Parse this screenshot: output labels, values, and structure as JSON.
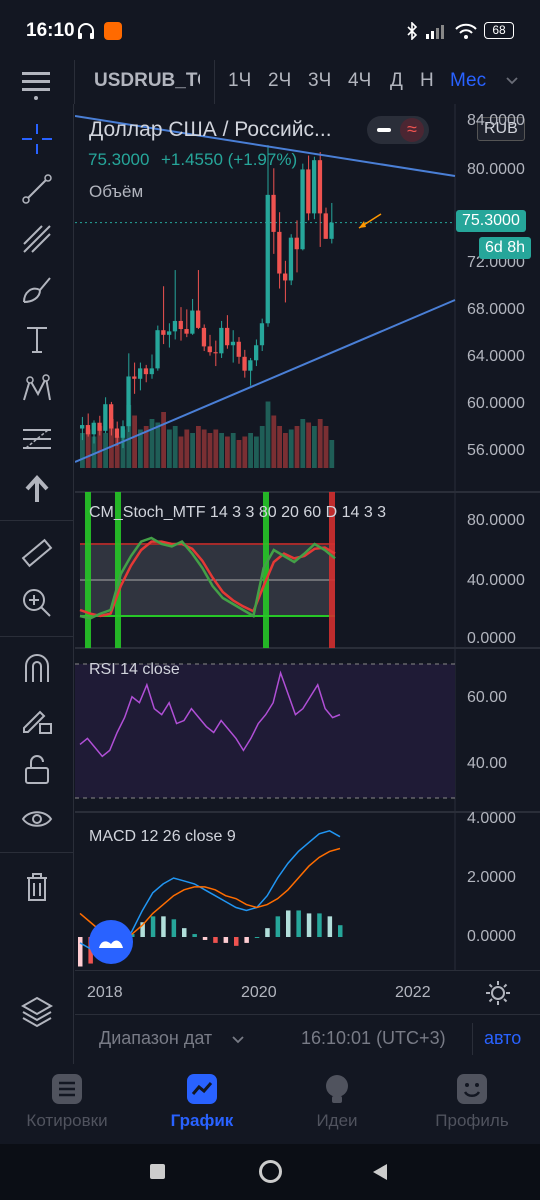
{
  "status_bar": {
    "time": "16:10",
    "battery": "68"
  },
  "top_bar": {
    "symbol": "USDRUB_TO",
    "timeframes": [
      "1Ч",
      "2Ч",
      "3Ч",
      "4Ч",
      "Д",
      "Н",
      "Мес"
    ],
    "active_timeframe": "Мес"
  },
  "legend": {
    "title": "Доллар США / Российс...",
    "price": "75.3000",
    "change": "+1.4550 (+1.97%)",
    "volume_label": "Объём",
    "currency": "RUB"
  },
  "price_axis": {
    "ticks": [
      "84.0000",
      "80.0000",
      "72.0000",
      "68.0000",
      "64.0000",
      "60.0000",
      "56.0000"
    ],
    "current_price": "75.3000",
    "countdown": "6d 8h"
  },
  "stoch_panel": {
    "label": "CM_Stoch_MTF 14 3 3 80 20 60 D 14 3 3",
    "ticks": [
      "80.0000",
      "40.0000",
      "0.0000"
    ]
  },
  "rsi_panel": {
    "label": "RSI 14 close",
    "ticks": [
      "60.00",
      "40.00"
    ]
  },
  "macd_panel": {
    "label": "MACD 12 26 close 9",
    "ticks": [
      "4.0000",
      "2.0000",
      "0.0000"
    ]
  },
  "time_axis": {
    "labels": [
      "2018",
      "2020",
      "2022"
    ]
  },
  "bottom_bar": {
    "date_range": "Диапазон дат",
    "clock": "16:10:01 (UTC+3)",
    "auto": "авто"
  },
  "nav": {
    "quotes": "Котировки",
    "chart": "График",
    "ideas": "Идеи",
    "profile": "Профиль"
  },
  "colors": {
    "up": "#26a69a",
    "down": "#ef5350",
    "accent": "#2962ff",
    "trendline": "#4a7fd6",
    "background": "#131722"
  },
  "chart_data": {
    "type": "candlestick",
    "title": "Доллар США / Российс...",
    "interval": "Мес",
    "ylim": [
      54,
      84
    ],
    "candles": [
      {
        "o": 57.5,
        "h": 58.5,
        "l": 56.5,
        "c": 57.8
      },
      {
        "o": 57.8,
        "h": 58.8,
        "l": 56.8,
        "c": 57.0
      },
      {
        "o": 57.0,
        "h": 58.2,
        "l": 56.2,
        "c": 58.0
      },
      {
        "o": 58.0,
        "h": 58.6,
        "l": 56.9,
        "c": 57.3
      },
      {
        "o": 57.3,
        "h": 60.2,
        "l": 57.1,
        "c": 59.6
      },
      {
        "o": 59.6,
        "h": 59.8,
        "l": 56.9,
        "c": 57.5
      },
      {
        "o": 57.5,
        "h": 58.1,
        "l": 56.0,
        "c": 56.7
      },
      {
        "o": 56.7,
        "h": 58.2,
        "l": 55.8,
        "c": 57.7
      },
      {
        "o": 57.7,
        "h": 64.0,
        "l": 57.2,
        "c": 62.0
      },
      {
        "o": 62.0,
        "h": 63.2,
        "l": 60.5,
        "c": 61.8
      },
      {
        "o": 61.8,
        "h": 63.2,
        "l": 60.8,
        "c": 62.7
      },
      {
        "o": 62.7,
        "h": 63.0,
        "l": 61.5,
        "c": 62.2
      },
      {
        "o": 62.2,
        "h": 63.9,
        "l": 61.8,
        "c": 62.7
      },
      {
        "o": 62.7,
        "h": 66.4,
        "l": 62.5,
        "c": 66.0
      },
      {
        "o": 66.0,
        "h": 69.8,
        "l": 64.8,
        "c": 65.6
      },
      {
        "o": 65.6,
        "h": 66.6,
        "l": 64.5,
        "c": 65.9
      },
      {
        "o": 65.9,
        "h": 71.2,
        "l": 65.2,
        "c": 66.8
      },
      {
        "o": 66.8,
        "h": 68.0,
        "l": 65.1,
        "c": 66.1
      },
      {
        "o": 66.1,
        "h": 67.8,
        "l": 65.4,
        "c": 65.7
      },
      {
        "o": 65.7,
        "h": 68.7,
        "l": 65.6,
        "c": 67.7
      },
      {
        "o": 67.7,
        "h": 71.2,
        "l": 66.1,
        "c": 66.2
      },
      {
        "o": 66.2,
        "h": 66.5,
        "l": 64.2,
        "c": 64.6
      },
      {
        "o": 64.6,
        "h": 65.6,
        "l": 63.8,
        "c": 64.1
      },
      {
        "o": 64.1,
        "h": 65.1,
        "l": 62.9,
        "c": 64.0
      },
      {
        "o": 64.0,
        "h": 66.8,
        "l": 63.6,
        "c": 66.2
      },
      {
        "o": 66.2,
        "h": 67.3,
        "l": 64.4,
        "c": 64.7
      },
      {
        "o": 64.7,
        "h": 66.0,
        "l": 63.2,
        "c": 65.0
      },
      {
        "o": 65.0,
        "h": 65.4,
        "l": 63.1,
        "c": 63.7
      },
      {
        "o": 63.7,
        "h": 64.3,
        "l": 61.9,
        "c": 62.5
      },
      {
        "o": 62.5,
        "h": 63.6,
        "l": 61.2,
        "c": 63.4
      },
      {
        "o": 63.4,
        "h": 65.2,
        "l": 62.9,
        "c": 64.7
      },
      {
        "o": 64.7,
        "h": 67.0,
        "l": 64.2,
        "c": 66.6
      },
      {
        "o": 66.6,
        "h": 82.0,
        "l": 66.3,
        "c": 77.7
      },
      {
        "o": 77.7,
        "h": 80.0,
        "l": 72.6,
        "c": 74.5
      },
      {
        "o": 74.5,
        "h": 76.2,
        "l": 69.6,
        "c": 70.9
      },
      {
        "o": 70.9,
        "h": 72.0,
        "l": 68.4,
        "c": 70.3
      },
      {
        "o": 70.3,
        "h": 74.3,
        "l": 69.9,
        "c": 74.0
      },
      {
        "o": 74.0,
        "h": 75.5,
        "l": 71.0,
        "c": 73.0
      },
      {
        "o": 73.0,
        "h": 80.4,
        "l": 72.9,
        "c": 79.9
      },
      {
        "o": 79.9,
        "h": 81.1,
        "l": 75.5,
        "c": 76.1
      },
      {
        "o": 76.1,
        "h": 81.0,
        "l": 75.6,
        "c": 80.7
      },
      {
        "o": 80.7,
        "h": 81.4,
        "l": 73.2,
        "c": 76.1
      },
      {
        "o": 76.1,
        "h": 76.6,
        "l": 73.9,
        "c": 73.9
      },
      {
        "o": 73.9,
        "h": 77.0,
        "l": 73.5,
        "c": 75.3
      }
    ],
    "volume": [
      0.5,
      0.55,
      0.45,
      0.6,
      0.5,
      0.7,
      0.45,
      0.55,
      0.9,
      0.75,
      0.55,
      0.6,
      0.7,
      0.65,
      0.8,
      0.55,
      0.6,
      0.45,
      0.55,
      0.5,
      0.6,
      0.55,
      0.5,
      0.55,
      0.5,
      0.45,
      0.5,
      0.4,
      0.45,
      0.5,
      0.45,
      0.6,
      0.95,
      0.75,
      0.6,
      0.5,
      0.55,
      0.6,
      0.7,
      0.65,
      0.6,
      0.7,
      0.6,
      0.4
    ],
    "rsi": [
      48,
      50,
      47,
      44,
      46,
      52,
      57,
      64,
      62,
      68,
      60,
      58,
      62,
      55,
      56,
      60,
      57,
      54,
      52,
      56,
      53,
      50,
      46,
      50,
      55,
      58,
      62,
      72,
      65,
      58,
      60,
      64,
      68,
      60,
      57,
      58
    ],
    "macd": [
      -0.2,
      -0.4,
      -0.5,
      -0.4,
      -0.3,
      0.2,
      0.9,
      1.5,
      1.8,
      2.0,
      1.9,
      1.8,
      1.6,
      1.4,
      1.2,
      1.0,
      0.9,
      1.0,
      1.4,
      2.0,
      2.5,
      2.9,
      3.2,
      3.5,
      3.6,
      3.4
    ],
    "macd_signal": [
      0.8,
      0.5,
      0.2,
      0.0,
      0.0,
      0.1,
      0.4,
      0.8,
      1.1,
      1.4,
      1.6,
      1.7,
      1.7,
      1.6,
      1.4,
      1.3,
      1.1,
      1.0,
      1.1,
      1.3,
      1.6,
      2.0,
      2.4,
      2.7,
      2.9,
      3.0
    ],
    "stoch_k": [
      20,
      18,
      22,
      25,
      55,
      70,
      82,
      85,
      80,
      78,
      82,
      72,
      60,
      45,
      35,
      30,
      25,
      20,
      60,
      75,
      70,
      65,
      72,
      80,
      75,
      68
    ],
    "stoch_d": [
      25,
      22,
      20,
      22,
      45,
      62,
      75,
      82,
      82,
      80,
      80,
      76,
      66,
      52,
      40,
      33,
      28,
      24,
      45,
      65,
      72,
      68,
      70,
      76,
      77,
      72
    ],
    "xlabels": [
      "2018",
      "2020",
      "2022"
    ]
  }
}
